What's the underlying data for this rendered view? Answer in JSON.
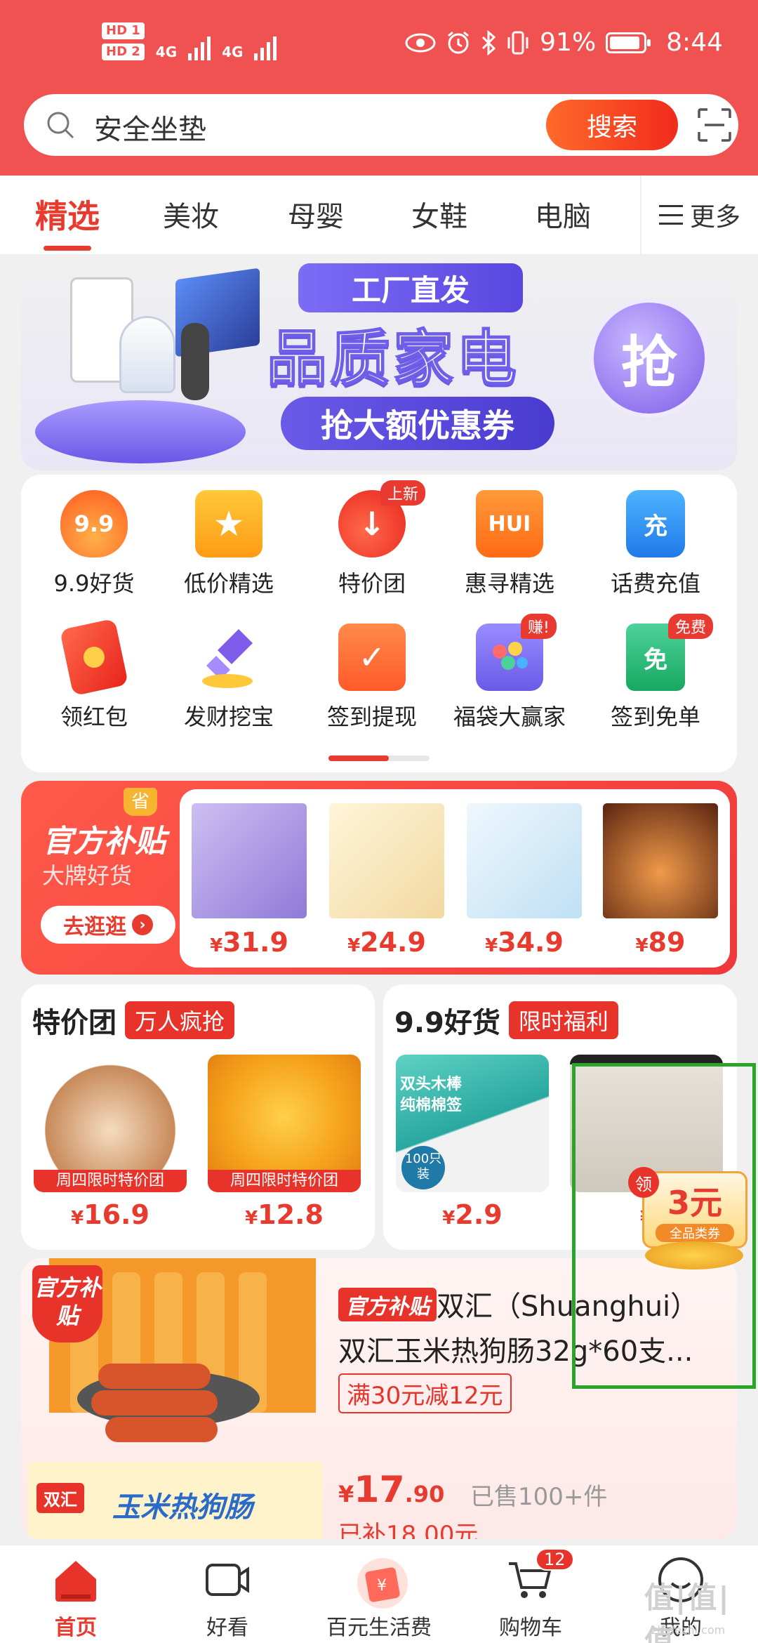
{
  "status_bar": {
    "sim1": "HD 1",
    "sim2": "HD 2",
    "net1": "4G",
    "net2": "4G",
    "battery": "91%",
    "time": "8:44"
  },
  "search": {
    "query": "安全坐垫",
    "button_label": "搜索"
  },
  "tabs": {
    "items": [
      "精选",
      "美妆",
      "母婴",
      "女鞋",
      "电脑"
    ],
    "more_label": "更多",
    "active_index": 0
  },
  "banner": {
    "tag": "工厂直发",
    "headline": "品质家电",
    "subline": "抢大额优惠券",
    "grab_label": "抢"
  },
  "icon_grid": {
    "items": [
      {
        "label": "9.9好货",
        "icon": "flame-99-icon",
        "icon_text": "9.9"
      },
      {
        "label": "低价精选",
        "icon": "star-bag-icon"
      },
      {
        "label": "特价团",
        "icon": "down-arrow-fire-icon",
        "badge": "上新"
      },
      {
        "label": "惠寻精选",
        "icon": "hui-bag-icon",
        "icon_text": "HUI"
      },
      {
        "label": "话费充值",
        "icon": "phone-recharge-icon",
        "icon_text": "充"
      },
      {
        "label": "领红包",
        "icon": "red-envelope-icon"
      },
      {
        "label": "发财挖宝",
        "icon": "shovel-treasure-icon"
      },
      {
        "label": "签到提现",
        "icon": "calendar-check-icon"
      },
      {
        "label": "福袋大赢家",
        "icon": "claw-machine-icon",
        "badge": "赚!"
      },
      {
        "label": "签到免单",
        "icon": "free-order-icon",
        "icon_text": "免",
        "badge": "免费"
      }
    ],
    "pager_progress": 0.6
  },
  "subsidy": {
    "title": "官方补贴",
    "subtitle": "大牌好货",
    "cta": "去逛逛",
    "save_badge": "省",
    "products": [
      {
        "price_symbol": "¥",
        "price": "31.9",
        "color": "#b8a7e8"
      },
      {
        "price_symbol": "¥",
        "price": "24.9",
        "color": "#f3e1b4"
      },
      {
        "price_symbol": "¥",
        "price": "34.9",
        "color": "#d9ecf7"
      },
      {
        "price_symbol": "¥",
        "price": "89",
        "color": "#8a3c20"
      }
    ]
  },
  "deals": [
    {
      "title": "特价团",
      "pill": "万人疯抢",
      "items": [
        {
          "strip": "周四限时特价团",
          "price_symbol": "¥",
          "price": "16.9",
          "color": "#efe0cf"
        },
        {
          "strip": "周四限时特价团",
          "price_symbol": "¥",
          "price": "12.8",
          "color": "#f6a21c"
        }
      ]
    },
    {
      "title": "9.9好货",
      "pill": "限时福利",
      "items": [
        {
          "strip": "",
          "price_symbol": "¥",
          "price": "2.9",
          "color": "#38b8b0"
        },
        {
          "strip": "",
          "price_symbol": "¥",
          "price": "",
          "color": "#d8d4cc"
        }
      ]
    }
  ],
  "cotton_swab": {
    "line1": "双头木棒",
    "line2": "纯棉棉签",
    "count": "100只",
    "unit": "装"
  },
  "floating_coupon": {
    "claim_label": "领",
    "amount": "3元",
    "type": "全品类券"
  },
  "product": {
    "ribbon": "官方补贴",
    "brand_tag": "官方补贴",
    "brand": "双汇（Shuanghui）",
    "title": "双汇玉米热狗肠32g*60支...",
    "coupon": "满30元减12元",
    "price_symbol": "¥",
    "price_int": "17",
    "price_dec": ".90",
    "sold": "已售100+件",
    "subsidized": "已补18.00元",
    "package_brand": "双汇",
    "package_name": "玉米热狗肠"
  },
  "bottom_nav": {
    "items": [
      {
        "label": "首页",
        "icon": "home-icon"
      },
      {
        "label": "好看",
        "icon": "video-icon"
      },
      {
        "label": "百元生活费",
        "icon": "gift-icon"
      },
      {
        "label": "购物车",
        "icon": "cart-icon",
        "count": "12"
      },
      {
        "label": "我的",
        "icon": "profile-icon"
      }
    ],
    "active_index": 0
  },
  "watermark": {
    "text": "值|值|值",
    "url": "zhidezhi.com"
  },
  "colors": {
    "brand_red": "#e63b2e",
    "header_red": "#f05252",
    "highlight_green": "#2aa52a"
  }
}
